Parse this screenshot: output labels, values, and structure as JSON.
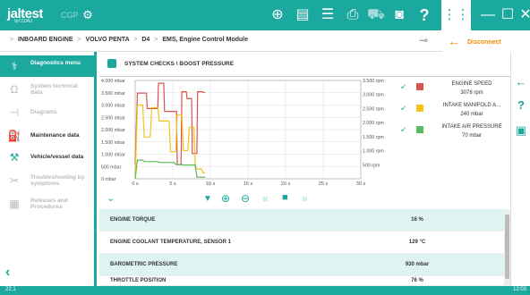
{
  "app": {
    "brand": "jaltest",
    "brand_sub": "by COJALI",
    "product": "CGP"
  },
  "breadcrumb": {
    "items": [
      "INBOARD ENGINE",
      "VOLVO PENTA",
      "D4",
      "EMS, Engine Control Module"
    ]
  },
  "disconnect_label": "Disconnect",
  "sidebar": {
    "items": [
      {
        "label": "Diagnostics menu",
        "icon": "diagnostics-icon",
        "state": "active"
      },
      {
        "label": "System technical data",
        "icon": "ohm-icon",
        "state": "dim"
      },
      {
        "label": "Diagrams",
        "icon": "diagram-icon",
        "state": "dim"
      },
      {
        "label": "Maintenance data",
        "icon": "oil-can-icon",
        "state": "norm"
      },
      {
        "label": "Vehicle/vessel data",
        "icon": "wrench-icon",
        "state": "norm"
      },
      {
        "label": "Troubleshooting by symptoms",
        "icon": "tools-icon",
        "state": "dim"
      },
      {
        "label": "Releases and Procedures",
        "icon": "document-icon",
        "state": "dim"
      }
    ]
  },
  "main": {
    "title": "SYSTEM CHECKS \\ BOOST PRESSURE"
  },
  "chart_data": {
    "type": "line",
    "x_ticks": [
      "0 s",
      "5 s",
      "10 s",
      "15 s",
      "20 s",
      "25 s",
      "30 s"
    ],
    "y_left_ticks": [
      "0 mbar",
      "500 mbar",
      "1.000 mbar",
      "1.500 mbar",
      "2.000 mbar",
      "2.500 mbar",
      "3.000 mbar",
      "3.500 mbar",
      "4.000 mbar"
    ],
    "y_right_ticks": [
      "500 rpm",
      "1.000 rpm",
      "1.500 rpm",
      "2.000 rpm",
      "2.500 rpm",
      "3.000 rpm",
      "3.500 rpm"
    ],
    "xlim": [
      0,
      30
    ],
    "ylim_left": [
      0,
      4000
    ],
    "ylim_right": [
      0,
      3500
    ],
    "grid": true,
    "series": [
      {
        "name": "ENGINE SPEED",
        "value_text": "3078 rpm",
        "color": "#d9534f",
        "axis": "right",
        "x": [
          0,
          0.3,
          1.5,
          1.6,
          3.0,
          3.1,
          3.8,
          3.9,
          4.2,
          5.5,
          5.6,
          6.1,
          6.2,
          6.8,
          6.9,
          7.5,
          7.6,
          8.2,
          8.3,
          8.9,
          9.0,
          9.3
        ],
        "y": [
          500,
          3050,
          3050,
          2500,
          2500,
          3400,
          3400,
          2400,
          2400,
          2400,
          500,
          500,
          3100,
          3100,
          2850,
          2850,
          900,
          900,
          3100,
          3100,
          3078,
          3078
        ]
      },
      {
        "name": "INTAKE MANIFOLD A...",
        "value_text": "240 mbar",
        "color": "#f0c419",
        "axis": "left",
        "x": [
          0,
          0.3,
          1.0,
          1.2,
          2.0,
          2.2,
          3.0,
          3.2,
          4.5,
          4.7,
          5.4,
          5.6,
          6.2,
          6.4,
          7.0,
          7.2,
          7.8,
          8.0,
          8.8,
          9.0,
          9.3
        ],
        "y": [
          0,
          3000,
          3000,
          1700,
          1700,
          2900,
          2900,
          2350,
          2350,
          1100,
          1100,
          2600,
          2600,
          1150,
          1150,
          2100,
          2100,
          400,
          400,
          240,
          240
        ]
      },
      {
        "name": "INTAKE AIR PRESSURE",
        "value_text": "70 mbar",
        "color": "#5cb85c",
        "axis": "left",
        "x": [
          0,
          0.3,
          1.0,
          1.2,
          3.0,
          3.2,
          5.2,
          5.4,
          6.2,
          6.4,
          8.0,
          8.2,
          9.3
        ],
        "y": [
          0,
          760,
          760,
          700,
          700,
          660,
          660,
          580,
          580,
          560,
          560,
          70,
          70
        ]
      }
    ]
  },
  "table": {
    "rows": [
      {
        "name": "ENGINE TORQUE",
        "value": "16 %"
      },
      {
        "name": "ENGINE COOLANT TEMPERATURE, SENSOR 1",
        "value": "129 °C"
      },
      {
        "name": "BAROMETRIC PRESSURE",
        "value": "930 mbar"
      },
      {
        "name": "THROTTLE POSITION",
        "value": "76 %"
      }
    ]
  },
  "status": {
    "left": "22.1",
    "right": "12:03"
  },
  "colors": {
    "accent": "#1aa89f",
    "warning": "#f08c00"
  }
}
